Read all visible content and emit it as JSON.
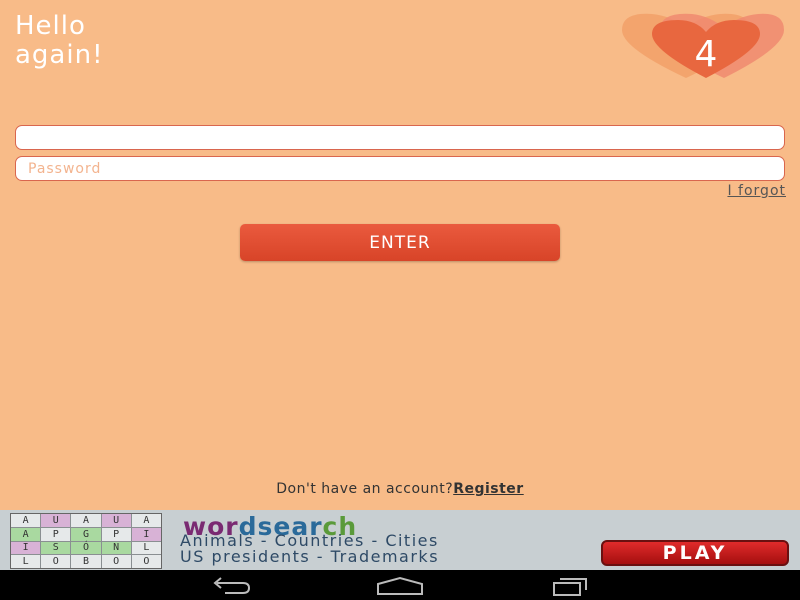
{
  "header": {
    "greeting_line1": "Hello",
    "greeting_line2": "again!",
    "logo_number": "4"
  },
  "login_form": {
    "username_value": "",
    "username_placeholder": "",
    "password_placeholder": "Password",
    "forgot_label": "I forgot",
    "enter_label": "ENTER"
  },
  "footer": {
    "no_account_text": "Don't have an account?",
    "register_label": "Register"
  },
  "ad": {
    "title_part1": "wor",
    "title_part2": "dsear",
    "title_part3": "ch",
    "line1": "Animals - Countries - Cities",
    "line2": "US presidents - Trademarks",
    "play_label": "PLAY",
    "grid_letters": [
      "A",
      "U",
      "A",
      "U",
      "A",
      "A",
      "P",
      "G",
      "P",
      "I",
      "I",
      "S",
      "Ó",
      "N",
      "L",
      "L",
      "O",
      "B",
      "O",
      "O"
    ]
  },
  "nav_icons": [
    "back-icon",
    "home-icon",
    "recent-apps-icon"
  ],
  "colors": {
    "background": "#f8bb88",
    "accent": "#e04e32",
    "logo": "#e8673f"
  }
}
